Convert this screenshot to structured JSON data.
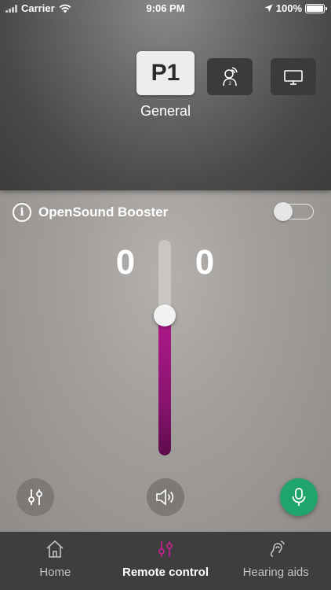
{
  "status_bar": {
    "carrier": "Carrier",
    "time": "9:06 PM",
    "battery": "100%"
  },
  "programs": {
    "active_label": "P1",
    "active_name": "General",
    "buttons": [
      {
        "label": "P1",
        "icon": "program-p1",
        "active": true
      },
      {
        "label": "",
        "icon": "speech-in-noise-person-icon",
        "active": false
      },
      {
        "label": "",
        "icon": "tv-icon",
        "active": false
      }
    ]
  },
  "booster": {
    "label": "OpenSound Booster",
    "enabled": false
  },
  "volume": {
    "left": "0",
    "right": "0",
    "level": 0.65
  },
  "controls": {
    "equalizer_icon": "sliders-icon",
    "speaker_icon": "speaker-icon",
    "mic_icon": "microphone-icon"
  },
  "colors": {
    "accent": "#b01a8c",
    "mic_button": "#1fa56b",
    "tabbar": "#3e3e3e"
  },
  "tabs": [
    {
      "label": "Home",
      "icon": "home-icon",
      "active": false
    },
    {
      "label": "Remote control",
      "icon": "sliders-icon",
      "active": true
    },
    {
      "label": "Hearing aids",
      "icon": "hearing-aid-icon",
      "active": false
    }
  ]
}
